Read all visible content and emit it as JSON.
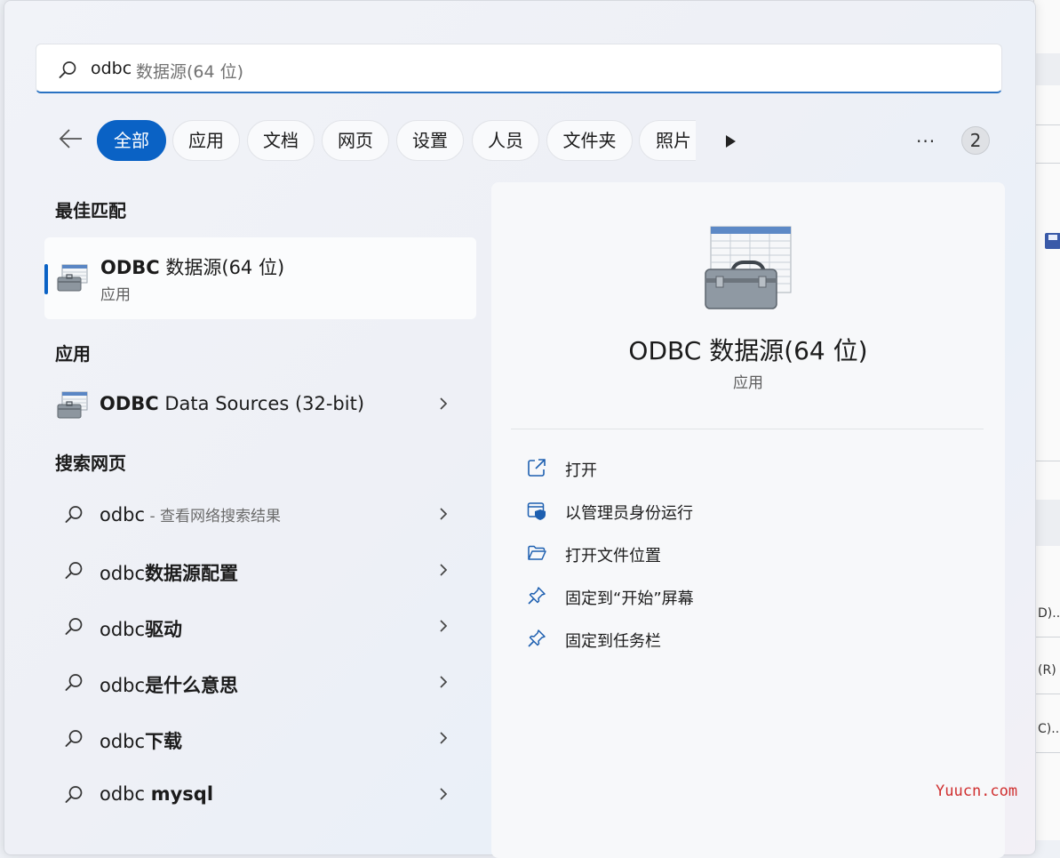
{
  "search": {
    "typed": "odbc",
    "ghost": " 数据源(64 位)"
  },
  "filters": {
    "chips": [
      "全部",
      "应用",
      "文档",
      "网页",
      "设置",
      "人员",
      "文件夹",
      "照片"
    ],
    "badge": "2",
    "more": "···"
  },
  "sections": {
    "best_match": "最佳匹配",
    "apps": "应用",
    "web_search": "搜索网页"
  },
  "best_match": {
    "name_bold": "ODBC",
    "name_rest": " 数据源(64 位)",
    "type": "应用"
  },
  "apps": [
    {
      "name_bold": "ODBC",
      "name_rest": " Data Sources (32-bit)"
    }
  ],
  "web_results": [
    {
      "plain": "odbc",
      "bold": "",
      "hint": " - 查看网络搜索结果"
    },
    {
      "plain": "odbc",
      "bold": "数据源配置",
      "hint": ""
    },
    {
      "plain": "odbc",
      "bold": "驱动",
      "hint": ""
    },
    {
      "plain": "odbc",
      "bold": "是什么意思",
      "hint": ""
    },
    {
      "plain": "odbc",
      "bold": "下载",
      "hint": ""
    },
    {
      "plain": "odbc ",
      "bold": "mysql",
      "hint": ""
    }
  ],
  "preview": {
    "title": "ODBC 数据源(64 位)",
    "type": "应用",
    "actions": [
      {
        "label": "打开",
        "icon": "open-external-icon"
      },
      {
        "label": "以管理员身份运行",
        "icon": "run-as-admin-icon"
      },
      {
        "label": "打开文件位置",
        "icon": "folder-open-icon"
      },
      {
        "label": "固定到“开始”屏幕",
        "icon": "pin-icon"
      },
      {
        "label": "固定到任务栏",
        "icon": "pin-icon"
      }
    ]
  },
  "background_app": {
    "fragments": [
      "D)...",
      "(R)",
      "C)..."
    ]
  },
  "watermark": "Yuucn.com",
  "colors": {
    "accent": "#0a62c5",
    "watermark": "#d03030"
  }
}
